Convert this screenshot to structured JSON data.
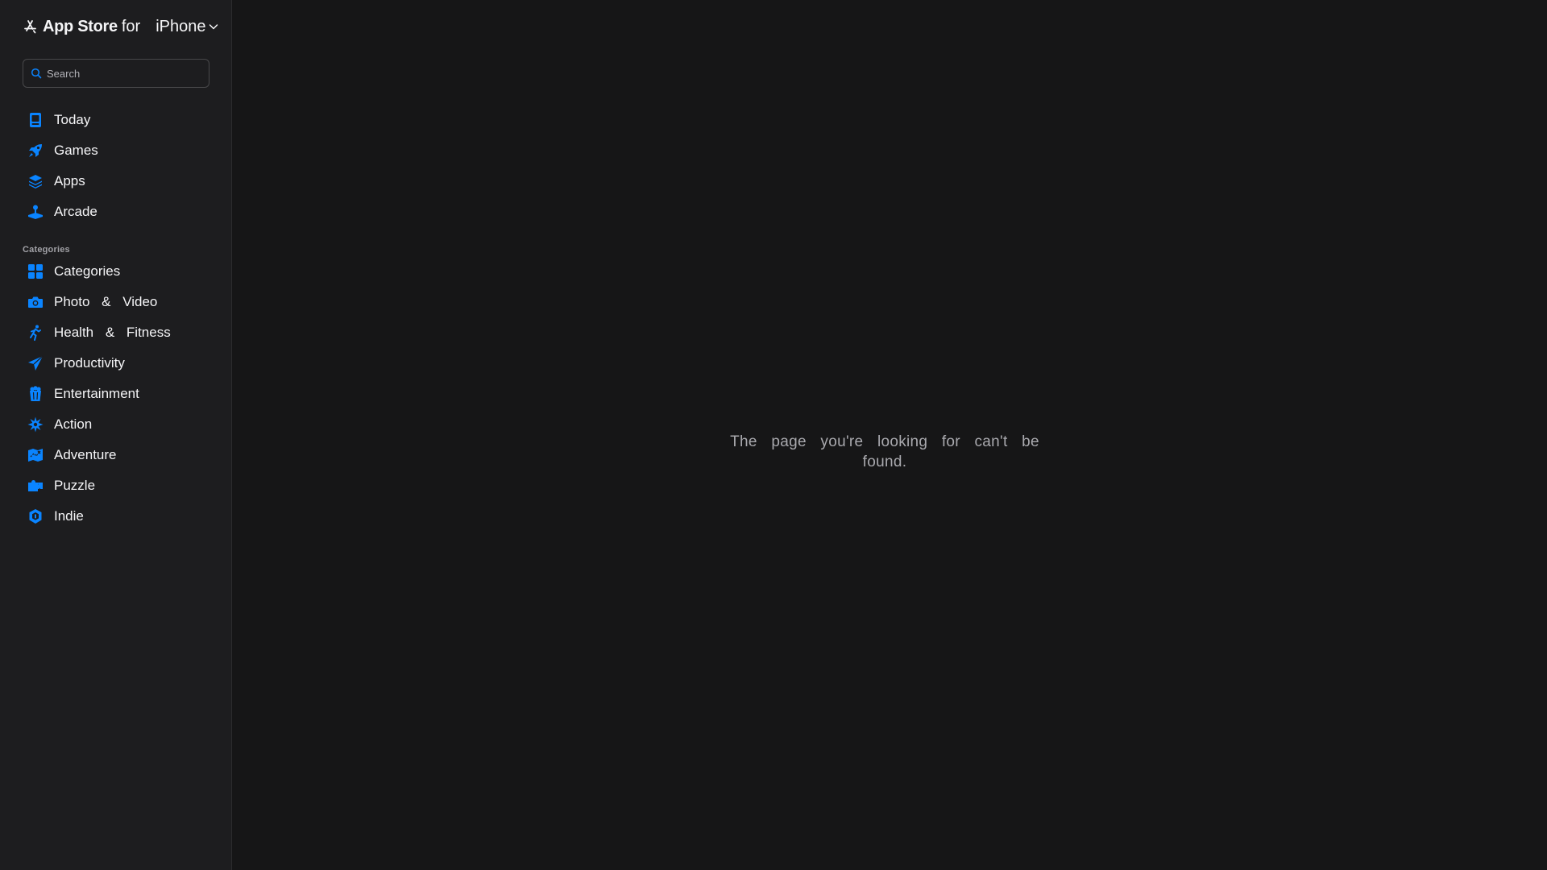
{
  "header": {
    "brand_name": "App Store",
    "brand_for": "for",
    "platform": "iPhone",
    "logo_icon": "app-store-icon",
    "chevron_icon": "chevron-down-icon"
  },
  "search": {
    "placeholder": "Search",
    "value": ""
  },
  "nav": {
    "items": [
      {
        "label": "Today",
        "icon": "today-icon"
      },
      {
        "label": "Games",
        "icon": "rocket-icon"
      },
      {
        "label": "Apps",
        "icon": "layers-icon"
      },
      {
        "label": "Arcade",
        "icon": "joystick-icon"
      }
    ]
  },
  "categories": {
    "section_label": "Categories",
    "items": [
      {
        "label": "Categories",
        "icon": "grid-icon"
      },
      {
        "label": "Photo & Video",
        "icon": "camera-icon"
      },
      {
        "label": "Health & Fitness",
        "icon": "running-icon"
      },
      {
        "label": "Productivity",
        "icon": "paper-plane-icon"
      },
      {
        "label": "Entertainment",
        "icon": "popcorn-icon"
      },
      {
        "label": "Action",
        "icon": "burst-icon"
      },
      {
        "label": "Adventure",
        "icon": "map-icon"
      },
      {
        "label": "Puzzle",
        "icon": "puzzle-icon"
      },
      {
        "label": "Indie",
        "icon": "indie-icon"
      }
    ]
  },
  "main": {
    "message": "The page you're looking for can't be found."
  },
  "colors": {
    "accent": "#0a84ff",
    "sidebar_bg": "#1d1d1f",
    "main_bg": "#161617"
  }
}
